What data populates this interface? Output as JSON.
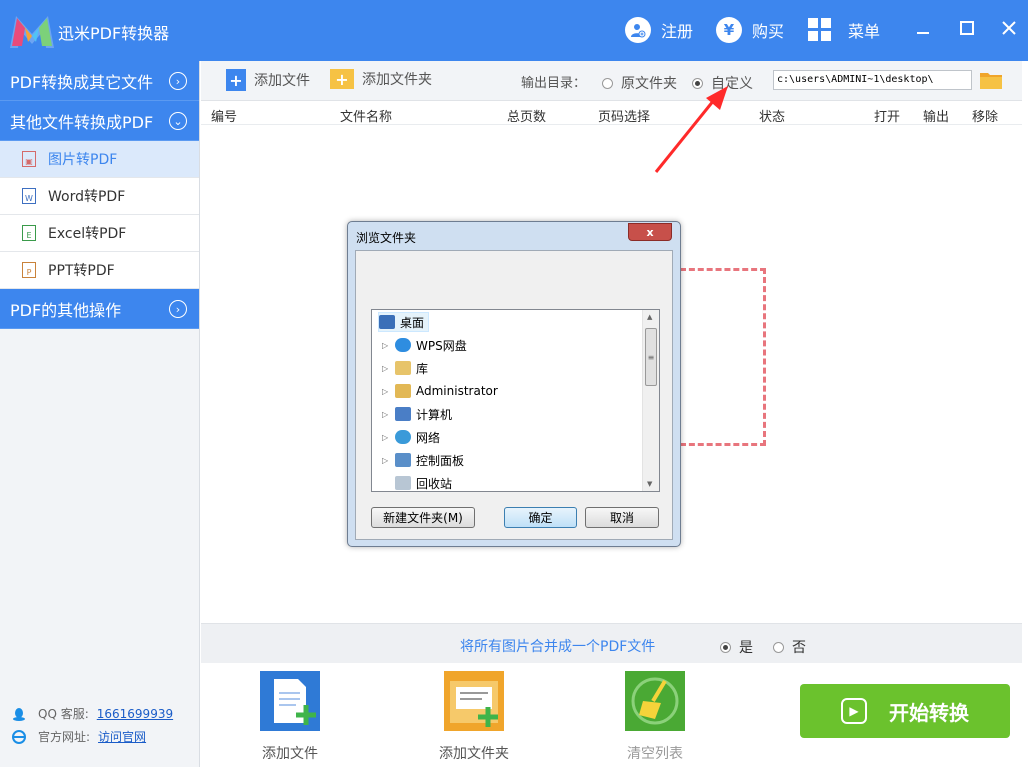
{
  "app": {
    "title": "迅米PDF转换器",
    "register": "注册",
    "register_icon": "user-add-icon",
    "buy": "购买",
    "buy_icon_glyph": "¥",
    "menu": "菜单",
    "accent": "#3d86ee"
  },
  "sidebar": {
    "sections": [
      {
        "label": "PDF转换成其它文件"
      },
      {
        "label": "其他文件转换成PDF"
      },
      {
        "label": "PDF的其他操作"
      }
    ],
    "items": [
      {
        "label": "图片转PDF",
        "icon_glyph": "▣"
      },
      {
        "label": "Word转PDF",
        "icon_glyph": "W"
      },
      {
        "label": "Excel转PDF",
        "icon_glyph": "E"
      },
      {
        "label": "PPT转PDF",
        "icon_glyph": "P"
      }
    ],
    "qq_label": "QQ 客服:",
    "qq_number": "1661699939",
    "site_label": "官方网址:",
    "site_link": "访问官网"
  },
  "toolbar": {
    "add_file": "添加文件",
    "add_folder": "添加文件夹",
    "output_label": "输出目录：",
    "option_original": "原文件夹",
    "option_custom": "自定义",
    "output_path": "c:\\users\\ADMINI~1\\desktop\\"
  },
  "table": {
    "columns": [
      "编号",
      "文件名称",
      "总页数",
      "页码选择",
      "状态",
      "打开",
      "输出",
      "移除"
    ]
  },
  "merge": {
    "label": "将所有图片合并成一个PDF文件",
    "yes": "是",
    "no": "否"
  },
  "bottom": {
    "add_file": "添加文件",
    "add_folder": "添加文件夹",
    "clear_list": "清空列表",
    "start": "开始转换",
    "start_color": "#6bc22d"
  },
  "dialog": {
    "title": "浏览文件夹",
    "close_glyph": "x",
    "tree": [
      {
        "label": "桌面",
        "icon": "desktop-icon",
        "expandable": false
      },
      {
        "label": "WPS网盘",
        "icon": "cloud-icon",
        "expandable": true
      },
      {
        "label": "库",
        "icon": "library-icon",
        "expandable": true
      },
      {
        "label": "Administrator",
        "icon": "user-folder-icon",
        "expandable": true
      },
      {
        "label": "计算机",
        "icon": "computer-icon",
        "expandable": true
      },
      {
        "label": "网络",
        "icon": "network-icon",
        "expandable": true
      },
      {
        "label": "控制面板",
        "icon": "control-panel-icon",
        "expandable": true
      },
      {
        "label": "回收站",
        "icon": "recycle-bin-icon",
        "expandable": false
      }
    ],
    "new_folder": "新建文件夹(M)",
    "ok": "确定",
    "cancel": "取消"
  }
}
